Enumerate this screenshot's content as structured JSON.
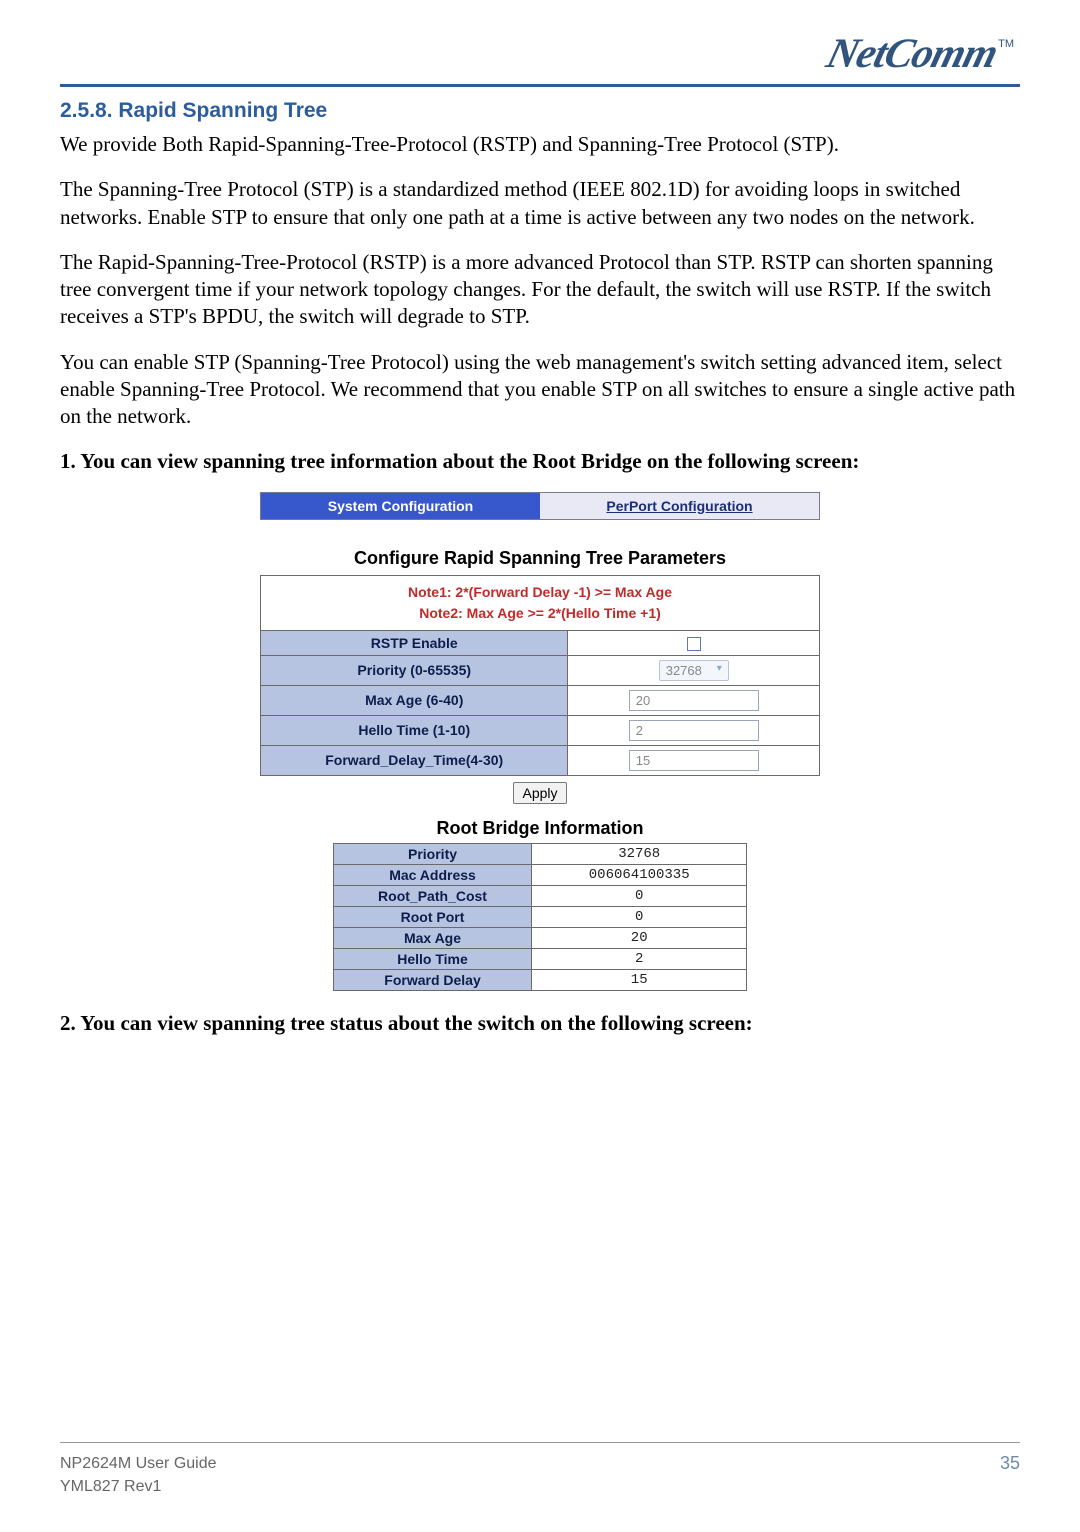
{
  "header": {
    "logo_text": "NetComm",
    "tm": "TM"
  },
  "section": {
    "number_title": "2.5.8. Rapid Spanning Tree",
    "p1": "We provide Both Rapid-Spanning-Tree-Protocol (RSTP) and Spanning-Tree Protocol (STP).",
    "p2": "The Spanning-Tree Protocol (STP) is a standardized method (IEEE 802.1D) for avoiding loops in switched networks.  Enable STP to ensure that only one path at a time is active between any two nodes on the network.",
    "p3": "The Rapid-Spanning-Tree-Protocol (RSTP) is a more advanced Protocol than STP.  RSTP can shorten spanning tree convergent time if your network topology changes.  For the default, the switch will use RSTP.  If the switch receives a STP's BPDU, the switch will degrade to STP.",
    "p4": "You can enable STP (Spanning-Tree Protocol) using the web management's switch setting advanced item, select enable Spanning-Tree Protocol.  We  recommend that you enable STP on all switches to ensure a single active path on the network.",
    "step1": "1. You can view spanning tree information about the Root Bridge on the following screen:",
    "step2": "2. You can view spanning tree status about the switch on the following screen:"
  },
  "tabs": {
    "active": "System Configuration",
    "inactive": "PerPort Configuration"
  },
  "config": {
    "title": "Configure Rapid Spanning Tree Parameters",
    "note1": "Note1: 2*(Forward Delay -1) >= Max Age",
    "note2": "Note2: Max Age >= 2*(Hello Time +1)",
    "rows": [
      {
        "label": "RSTP Enable",
        "type": "checkbox",
        "value": ""
      },
      {
        "label": "Priority (0-65535)",
        "type": "select",
        "value": "32768"
      },
      {
        "label": "Max Age (6-40)",
        "type": "text",
        "value": "20"
      },
      {
        "label": "Hello Time (1-10)",
        "type": "text",
        "value": "2"
      },
      {
        "label": "Forward_Delay_Time(4-30)",
        "type": "text",
        "value": "15"
      }
    ],
    "apply": "Apply"
  },
  "root_info": {
    "title": "Root Bridge Information",
    "rows": [
      {
        "label": "Priority",
        "value": "32768"
      },
      {
        "label": "Mac Address",
        "value": "006064100335"
      },
      {
        "label": "Root_Path_Cost",
        "value": "0"
      },
      {
        "label": "Root Port",
        "value": "0"
      },
      {
        "label": "Max Age",
        "value": "20"
      },
      {
        "label": "Hello Time",
        "value": "2"
      },
      {
        "label": "Forward Delay",
        "value": "15"
      }
    ]
  },
  "footer": {
    "line1": "NP2624M User Guide",
    "line2": "YML827 Rev1",
    "page": "35"
  }
}
